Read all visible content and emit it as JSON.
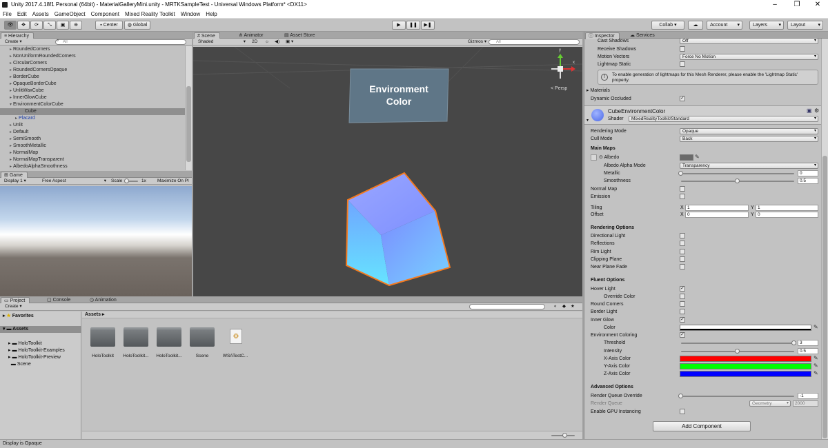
{
  "window": {
    "title": "Unity 2017.4.18f1 Personal (64bit) - MaterialGalleryMini.unity - MRTKSampleTest - Universal Windows Platform* <DX11>",
    "minimize": "–",
    "maximize": "❐",
    "close": "✕"
  },
  "menu": [
    "File",
    "Edit",
    "Assets",
    "GameObject",
    "Component",
    "Mixed Reality Toolkit",
    "Window",
    "Help"
  ],
  "toolbar": {
    "center": "Center",
    "global": "Global",
    "collab": "Collab ▾",
    "account": "Account",
    "layers": "Layers",
    "layout": "Layout"
  },
  "hierarchy": {
    "tab": "Hierarchy",
    "create": "Create ▾",
    "search_placeholder": "All",
    "items": [
      {
        "label": "RoundedCorners",
        "indent": 1
      },
      {
        "label": "NonUniformRoundedCorners",
        "indent": 1
      },
      {
        "label": "CircularCorners",
        "indent": 1
      },
      {
        "label": "RoundedCornersOpaque",
        "indent": 1
      },
      {
        "label": "BorderCube",
        "indent": 1
      },
      {
        "label": "OpaqueBorderCube",
        "indent": 1
      },
      {
        "label": "UnlitWaxCube",
        "indent": 1
      },
      {
        "label": "InnerGlowCube",
        "indent": 1
      },
      {
        "label": "EnvironmentColorCube",
        "indent": 1
      },
      {
        "label": "Cube",
        "indent": 2
      },
      {
        "label": "Placard",
        "indent": 2
      },
      {
        "label": "Unlit",
        "indent": 1
      },
      {
        "label": "Default",
        "indent": 1
      },
      {
        "label": "SemiSmooth",
        "indent": 1
      },
      {
        "label": "SmoothMetallic",
        "indent": 1
      },
      {
        "label": "NormalMap",
        "indent": 1
      },
      {
        "label": "NormalMapTransparent",
        "indent": 1
      },
      {
        "label": "AlbedoAlphaSmoothness",
        "indent": 1
      }
    ]
  },
  "game": {
    "tab": "Game",
    "display": "Display 1",
    "aspect": "Free Aspect",
    "scale_label": "Scale",
    "scale_value": "1x",
    "maximize": "Maximize On Pl"
  },
  "scene": {
    "tabs": [
      "Scene",
      "Animator",
      "Asset Store"
    ],
    "shaded": "Shaded",
    "mode2d": "2D",
    "gizmos": "Gizmos ▾",
    "search_placeholder": "All",
    "placard_line1": "Environment",
    "placard_line2": "Color",
    "persp": "< Persp",
    "axis_x": "x",
    "axis_y": "y"
  },
  "project": {
    "tabs": [
      "Project",
      "Console",
      "Animation"
    ],
    "create": "Create ▾",
    "favorites": "Favorites",
    "assets_root": "Assets",
    "tree": [
      "HoloToolkit",
      "HoloToolkit-Examples",
      "HoloToolkit-Preview",
      "Scene"
    ],
    "breadcrumb": "Assets ▸",
    "files": [
      {
        "label": "HoloToolkit",
        "type": "folder"
      },
      {
        "label": "HoloToolkit...",
        "type": "folder"
      },
      {
        "label": "HoloToolkit...",
        "type": "folder"
      },
      {
        "label": "Scene",
        "type": "folder"
      },
      {
        "label": "WSATestC...",
        "type": "script"
      }
    ]
  },
  "inspector": {
    "tabs": [
      "Inspector",
      "Services"
    ],
    "cast_shadows": {
      "label": "Cast Shadows",
      "value": "Off"
    },
    "receive_shadows": "Receive Shadows",
    "motion_vectors": {
      "label": "Motion Vectors",
      "value": "Force No Motion"
    },
    "lightmap_static": "Lightmap Static",
    "info": "To enable generation of lightmaps for this Mesh Renderer, please enable the 'Lightmap Static' property.",
    "materials": "Materials",
    "dynamic_occluded": "Dynamic Occluded",
    "material_name": "CubeEnvironmentColor",
    "shader_label": "Shader",
    "shader_value": "MixedRealityToolkit/Standard",
    "rendering_mode": {
      "label": "Rendering Mode",
      "value": "Opaque"
    },
    "cull_mode": {
      "label": "Cull Mode",
      "value": "Back"
    },
    "main_maps": "Main Maps",
    "albedo": "Albedo",
    "albedo_alpha_mode": {
      "label": "Albedo Alpha Mode",
      "value": "Transparency"
    },
    "metallic": {
      "label": "Metallic",
      "value": "0",
      "fraction": 0.0
    },
    "smoothness": {
      "label": "Smoothness",
      "value": "0.5",
      "fraction": 0.5
    },
    "normal_map": "Normal Map",
    "emission": "Emission",
    "tiling": {
      "label": "Tiling",
      "x_label": "X",
      "x": "1",
      "y_label": "Y",
      "y": "1"
    },
    "offset": {
      "label": "Offset",
      "x_label": "X",
      "x": "0",
      "y_label": "Y",
      "y": "0"
    },
    "rendering_options": "Rendering Options",
    "directional_light": "Directional Light",
    "reflections": "Reflections",
    "rim_light": "Rim Light",
    "clipping_plane": "Clipping Plane",
    "near_plane_fade": "Near Plane Fade",
    "fluent_options": "Fluent Options",
    "hover_light": "Hover Light",
    "override_color": "Override Color",
    "round_corners": "Round Corners",
    "border_light": "Border Light",
    "inner_glow": "Inner Glow",
    "color": "Color",
    "environment_coloring": "Environment Coloring",
    "threshold": {
      "label": "Threshold",
      "value": "3",
      "fraction": 1.0
    },
    "intensity": {
      "label": "Intensity",
      "value": "0.5",
      "fraction": 0.5
    },
    "x_axis_color": {
      "label": "X-Axis Color",
      "color": "#ff0000"
    },
    "y_axis_color": {
      "label": "Y-Axis Color",
      "color": "#00ff00"
    },
    "z_axis_color": {
      "label": "Z-Axis Color",
      "color": "#0000ff"
    },
    "advanced_options": "Advanced Options",
    "render_queue_override": {
      "label": "Render Queue Override",
      "value": "-1",
      "fraction": 0.0
    },
    "render_queue": {
      "label": "Render Queue",
      "mode": "Geometry",
      "value": "2000"
    },
    "enable_gpu_instancing": "Enable GPU Instancing",
    "add_component": "Add Component"
  },
  "status": "Display is Opaque"
}
